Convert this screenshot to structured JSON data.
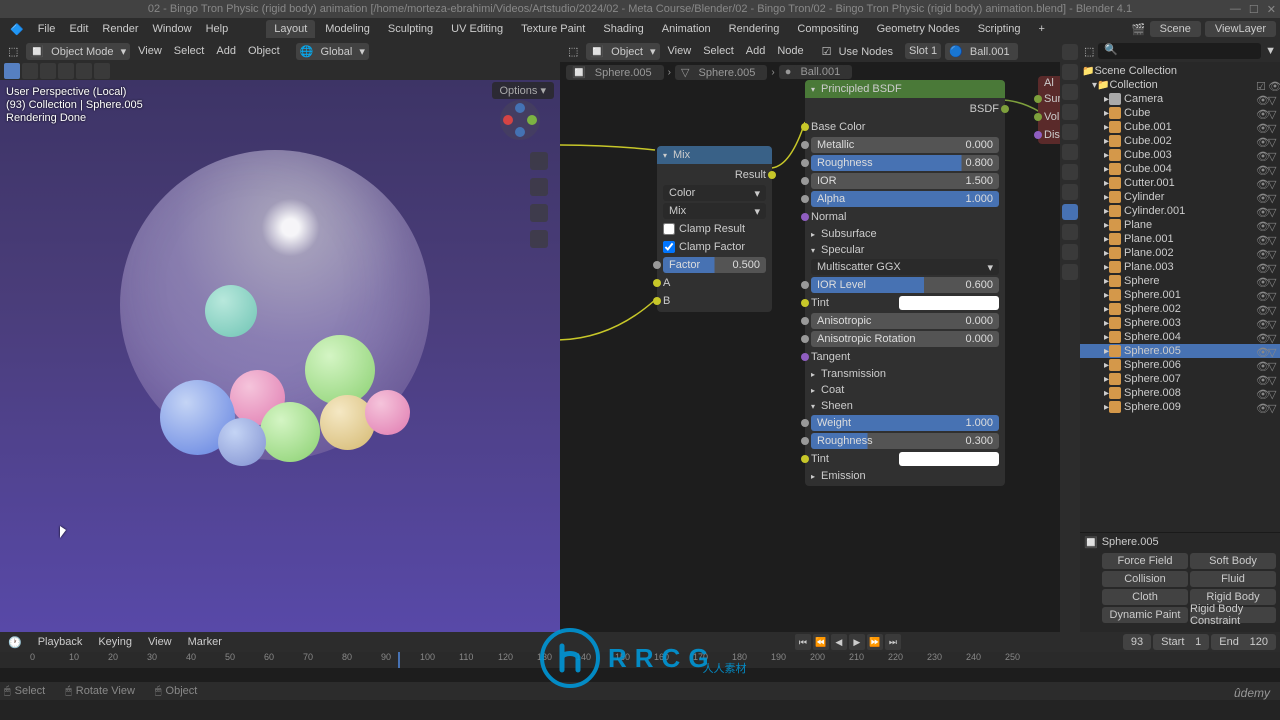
{
  "title": "02 - Bingo Tron Physic (rigid body) animation [/home/morteza-ebrahimi/Videos/Artstudio/2024/02 - Meta Course/Blender/02 - Bingo Tron/02 - Bingo Tron Physic (rigid body) animation.blend] - Blender 4.1",
  "menubar": {
    "items": [
      "File",
      "Edit",
      "Render",
      "Window",
      "Help"
    ],
    "tabs": [
      "Layout",
      "Modeling",
      "Sculpting",
      "UV Editing",
      "Texture Paint",
      "Shading",
      "Animation",
      "Rendering",
      "Compositing",
      "Geometry Nodes",
      "Scripting"
    ],
    "active_tab": "Layout",
    "scene": "Scene",
    "viewlayer": "ViewLayer"
  },
  "viewport": {
    "menus": [
      "View",
      "Select",
      "Add",
      "Object"
    ],
    "mode": "Object Mode",
    "orientation": "Global",
    "overlay_lines": [
      "User Perspective (Local)",
      "(93) Collection | Sphere.005",
      "Rendering Done"
    ],
    "options_label": "Options"
  },
  "node_editor": {
    "menus": [
      "View",
      "Select",
      "Add",
      "Node"
    ],
    "label_object": "Object",
    "use_nodes": "Use Nodes",
    "slot": "Slot 1",
    "material": "Ball.001",
    "crumbs": [
      "Sphere.005",
      "Sphere.005",
      "Ball.001"
    ]
  },
  "mix_node": {
    "title": "Mix",
    "result": "Result",
    "type": "Color",
    "mode": "Mix",
    "clamp_result": "Clamp Result",
    "clamp_factor": "Clamp Factor",
    "factor_label": "Factor",
    "factor_val": "0.500",
    "a": "A",
    "b": "B"
  },
  "bsdf_node": {
    "title": "Principled BSDF",
    "output": "BSDF",
    "base_color": "Base Color",
    "sliders": {
      "metallic": {
        "label": "Metallic",
        "val": "0.000",
        "fill": 0
      },
      "roughness": {
        "label": "Roughness",
        "val": "0.800",
        "fill": 80
      },
      "ior": {
        "label": "IOR",
        "val": "1.500",
        "fill": 0
      },
      "alpha": {
        "label": "Alpha",
        "val": "1.000",
        "fill": 100
      }
    },
    "normal": "Normal",
    "subsurface": "Subsurface",
    "specular": "Specular",
    "multiscatter": "Multiscatter GGX",
    "ior_level": {
      "label": "IOR Level",
      "val": "0.600",
      "fill": 60
    },
    "tint1": "Tint",
    "anisotropic": {
      "label": "Anisotropic",
      "val": "0.000"
    },
    "aniso_rot": {
      "label": "Anisotropic Rotation",
      "val": "0.000"
    },
    "tangent": "Tangent",
    "transmission": "Transmission",
    "coat": "Coat",
    "sheen": "Sheen",
    "weight": {
      "label": "Weight",
      "val": "1.000",
      "fill": 100
    },
    "rough2": {
      "label": "Roughness",
      "val": "0.300",
      "fill": 30
    },
    "tint2": "Tint",
    "emission": "Emission"
  },
  "output_node": {
    "items": [
      "Al",
      "Sur",
      "Vol",
      "Dis"
    ]
  },
  "outliner": {
    "top": "Scene Collection",
    "collection": "Collection",
    "items": [
      "Camera",
      "Cube",
      "Cube.001",
      "Cube.002",
      "Cube.003",
      "Cube.004",
      "Cutter.001",
      "Cylinder",
      "Cylinder.001",
      "Plane",
      "Plane.001",
      "Plane.002",
      "Plane.003",
      "Sphere",
      "Sphere.001",
      "Sphere.002",
      "Sphere.003",
      "Sphere.004",
      "Sphere.005",
      "Sphere.006",
      "Sphere.007",
      "Sphere.008",
      "Sphere.009"
    ],
    "selected": "Sphere.005"
  },
  "props": {
    "context": "Sphere.005",
    "buttons": [
      [
        "Force Field",
        "Soft Body"
      ],
      [
        "Collision",
        "Fluid"
      ],
      [
        "Cloth",
        "Rigid Body"
      ],
      [
        "Dynamic Paint",
        "Rigid Body Constraint"
      ]
    ]
  },
  "timeline": {
    "menus": [
      "Playback",
      "Keying",
      "View",
      "Marker"
    ],
    "current": "93",
    "start_label": "Start",
    "start_val": "1",
    "end_label": "End",
    "end_val": "120",
    "ticks": [
      "0",
      "10",
      "20",
      "30",
      "40",
      "50",
      "60",
      "70",
      "80",
      "90",
      "100",
      "110",
      "120",
      "130",
      "140",
      "150",
      "160",
      "170",
      "180",
      "190",
      "200",
      "210",
      "220",
      "230",
      "240",
      "250"
    ]
  },
  "statusbar": {
    "select": "Select",
    "rotate": "Rotate View",
    "object": "Object"
  },
  "watermark": {
    "text": "RRCG",
    "sub": "人人素材"
  },
  "udemy": "ûdemy"
}
